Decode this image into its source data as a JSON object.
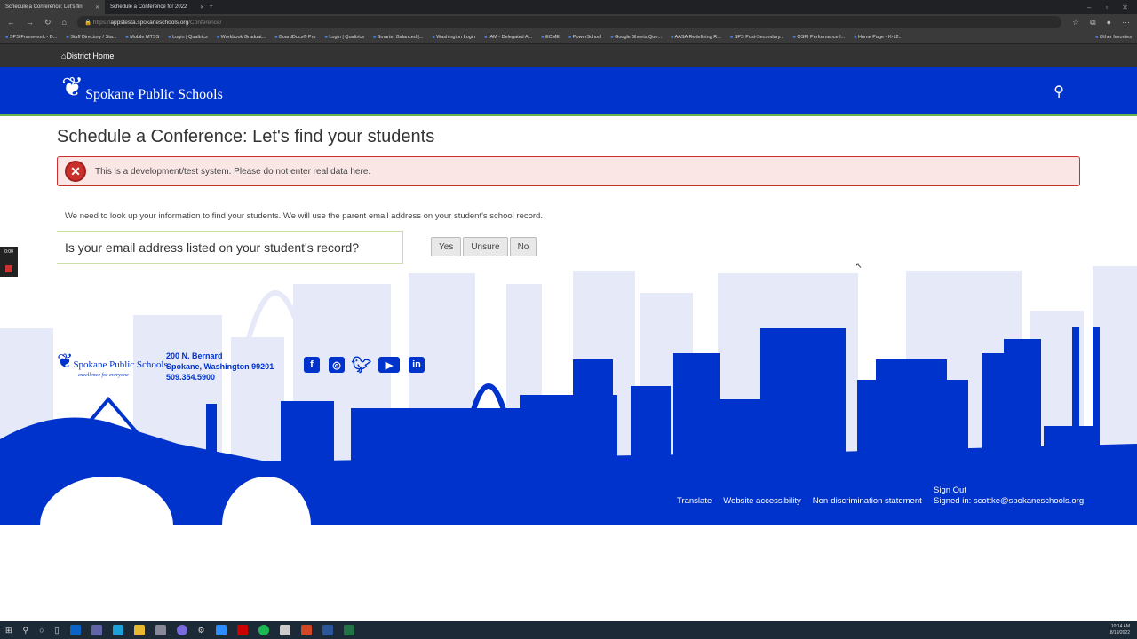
{
  "browser": {
    "tabs": [
      "Schedule a Conference: Let's fin",
      "Schedule a Conference for 2022"
    ],
    "url_prefix": "https://",
    "url_host": "appstesta.spokaneschools.org",
    "url_path": "/Conference/",
    "bookmarks": [
      "SPS Framework - D...",
      "Staff Directory / Sta...",
      "Mobile MTSS",
      "Login | Qualtrics",
      "Workbook Graduat...",
      "BoardDocs® Pro",
      "Login | Qualtrics",
      "Smarter Balanced |...",
      "Washington Login",
      "IAM - Delegated A...",
      "ECME",
      "PowerSchool",
      "Google Sheets Que...",
      "AASA Redefining R...",
      "SPS Post-Secondary...",
      "OSPI Performance I...",
      "Home Page - K-12...",
      "Other favorites"
    ]
  },
  "site": {
    "district_home": "District Home",
    "logo": "Spokane Public Schools"
  },
  "page": {
    "title": "Schedule a Conference: Let's find your students",
    "alert": "This is a development/test system. Please do not enter real data here.",
    "intro": "We need to look up your information to find your students. We will use the parent email address on your student's school record.",
    "question": "Is your email address listed on your student's record?",
    "yes": "Yes",
    "unsure": "Unsure",
    "no": "No"
  },
  "footer": {
    "logo": "Spokane Public Schools",
    "tagline": "excellence for everyone",
    "address1": "200 N. Bernard",
    "address2": "Spokane, Washington 99201",
    "phone": "509.354.5900",
    "links": [
      "Translate",
      "Website accessibility",
      "Non-discrimination statement"
    ],
    "sign_out": "Sign Out",
    "signed_in": "Signed in: scottke@spokaneschools.org"
  },
  "recorder": {
    "time": "0:00"
  },
  "taskbar": {
    "time": "10:14 AM",
    "date": "8/19/2022"
  }
}
